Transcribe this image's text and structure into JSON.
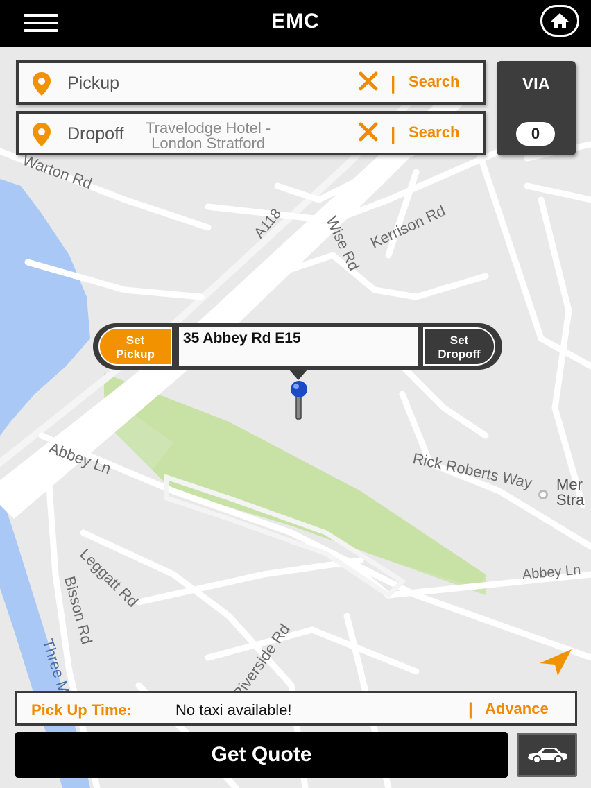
{
  "header": {
    "title": "EMC"
  },
  "pickup": {
    "placeholder": "Pickup",
    "search_label": "Search",
    "separator": "|"
  },
  "dropoff": {
    "placeholder": "Dropoff",
    "search_label": "Search",
    "separator": "|"
  },
  "via": {
    "label": "VIA",
    "count": "0"
  },
  "popup": {
    "set_pickup": "Set\nPickup",
    "address": "35 Abbey Rd E15",
    "set_dropoff": "Set\nDropoff"
  },
  "map": {
    "labels": {
      "warton_rd": "Warton Rd",
      "a118": "A118",
      "wise_rd": "Wise Rd",
      "kerrison_rd": "Kerrison Rd",
      "abbey_ln": "Abbey Ln",
      "rick_roberts_way": "Rick Roberts Way",
      "leggatt_rd": "Leggatt Rd",
      "bisson_rd": "Bisson Rd",
      "three_mills": "Three M",
      "riverside_rd": "Riverside Rd",
      "abbey_ln_2": "Abbey Ln",
      "travelodge": "Travelodge Hotel -\nLondon Stratford",
      "mer_stra": "Mer\nStra"
    },
    "colors": {
      "water": "#a9c8f6",
      "park": "#c8e2a5",
      "road": "#ffffff",
      "land": "#e9e9e9"
    }
  },
  "pickup_time": {
    "label": "Pick Up Time:",
    "value": "No taxi available!",
    "separator": "|",
    "advance_label": "Advance"
  },
  "quote": {
    "label": "Get Quote"
  },
  "colors": {
    "accent": "#f08a00",
    "dark": "#3a3a3a",
    "black": "#000000"
  },
  "icons": {
    "menu": "hamburger-icon",
    "home": "home-icon",
    "pin": "location-pin-icon",
    "clear": "close-icon",
    "car": "car-icon",
    "nav": "navigation-arrow-icon"
  }
}
